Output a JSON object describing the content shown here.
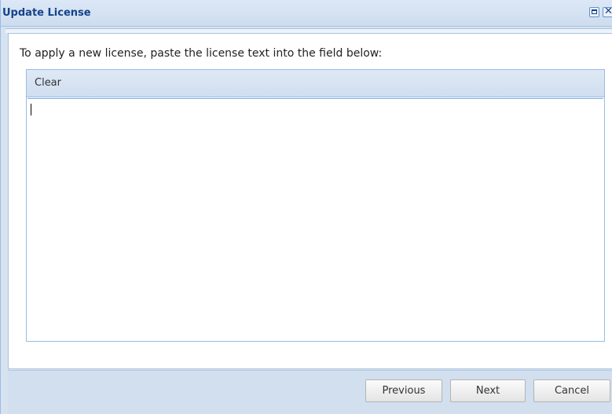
{
  "window": {
    "title": "Update License",
    "maximize_icon": "maximize-icon",
    "close_icon": "close-icon"
  },
  "main": {
    "instruction": "To apply a new license, paste the license text into the field below:",
    "toolbar": {
      "clear_label": "Clear"
    },
    "license_field": {
      "value": "",
      "placeholder": ""
    }
  },
  "footer": {
    "previous_label": "Previous",
    "next_label": "Next",
    "cancel_label": "Cancel"
  },
  "colors": {
    "title_text": "#15428b",
    "window_frame": "#d7e2ef",
    "panel_border": "#99bbe8"
  }
}
